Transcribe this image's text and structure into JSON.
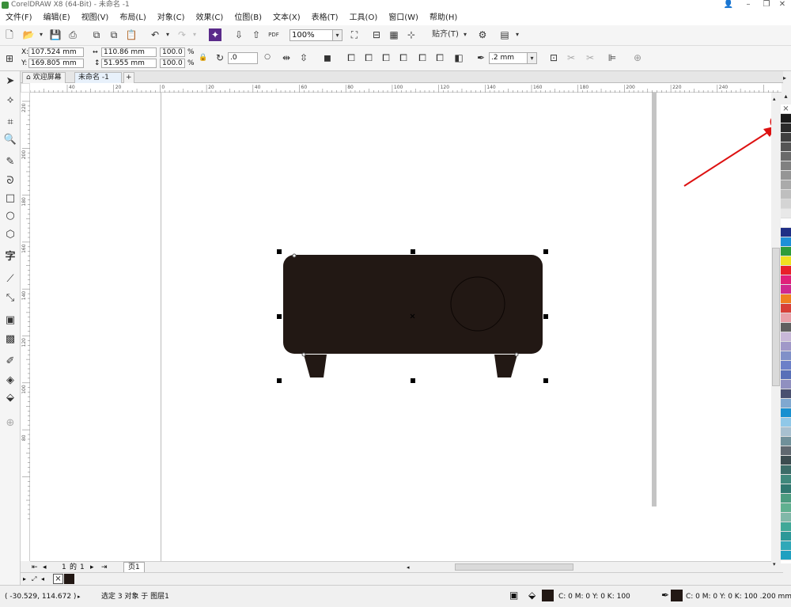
{
  "window": {
    "title": "CorelDRAW X8 (64-Bit) - 未命名 -1"
  },
  "menu": [
    "文件(F)",
    "编辑(E)",
    "视图(V)",
    "布局(L)",
    "对象(C)",
    "效果(C)",
    "位图(B)",
    "文本(X)",
    "表格(T)",
    "工具(O)",
    "窗口(W)",
    "帮助(H)"
  ],
  "toolbar": {
    "zoom": "100%",
    "snap_label": "贴齐(T)",
    "pdf_label": "PDF"
  },
  "props": {
    "x_label": "X:",
    "y_label": "Y:",
    "x": "107.524 mm",
    "y": "169.805 mm",
    "w": "110.86 mm",
    "h": "51.955 mm",
    "sx": "100.0",
    "sy": "100.0",
    "pct": "%",
    "rotation": ".0",
    "outline_width": ".2 mm"
  },
  "tabs": {
    "welcome": "欢迎屏幕",
    "doc": "未命名 -1",
    "add": "+"
  },
  "ruler": {
    "h_labels": [
      "40",
      "20",
      "0",
      "20",
      "40",
      "60",
      "80",
      "100",
      "120",
      "140",
      "160",
      "180",
      "200",
      "220",
      "240"
    ],
    "v_labels": [
      "220",
      "200",
      "180",
      "160",
      "140",
      "120",
      "100",
      "80"
    ]
  },
  "pager": {
    "current": "1",
    "of": "的",
    "total": "1",
    "page_tab": "页1"
  },
  "status": {
    "coords": "( -30.529, 114.672 )",
    "selection": "选定 3 对象 于 图层1",
    "fill_info": "C: 0 M: 0 Y: 0 K: 100",
    "outline_info": "C: 0 M: 0 Y: 0 K: 100  .200 mm"
  },
  "colors": {
    "accent": "#dd1111",
    "object_fill": "#221814",
    "palette": [
      "#1a1a1a",
      "#2a2a2a",
      "#404040",
      "#555555",
      "#6a6a6a",
      "#808080",
      "#959595",
      "#aaaaaa",
      "#bfbfbf",
      "#d4d4d4",
      "#e8e8e8",
      "#ffffff",
      "#1f2f86",
      "#1e90d8",
      "#2e9c3a",
      "#f0e020",
      "#e8202a",
      "#e0207a",
      "#d02890",
      "#f08020",
      "#d84038",
      "#e8a0a8",
      "#606060",
      "#c8b8d8",
      "#a098c8",
      "#8090c8",
      "#6c80c8",
      "#5870b8",
      "#9090c0",
      "#4a5070",
      "#80a8d0",
      "#1890d0",
      "#90c8e8",
      "#a8c0d0",
      "#70909a",
      "#606870",
      "#3c4c50",
      "#3c6c68",
      "#40887c",
      "#307870",
      "#4c9c80",
      "#60b090",
      "#80b8a8",
      "#40a898",
      "#2c9898",
      "#30a8b8",
      "#20a0c0"
    ]
  }
}
